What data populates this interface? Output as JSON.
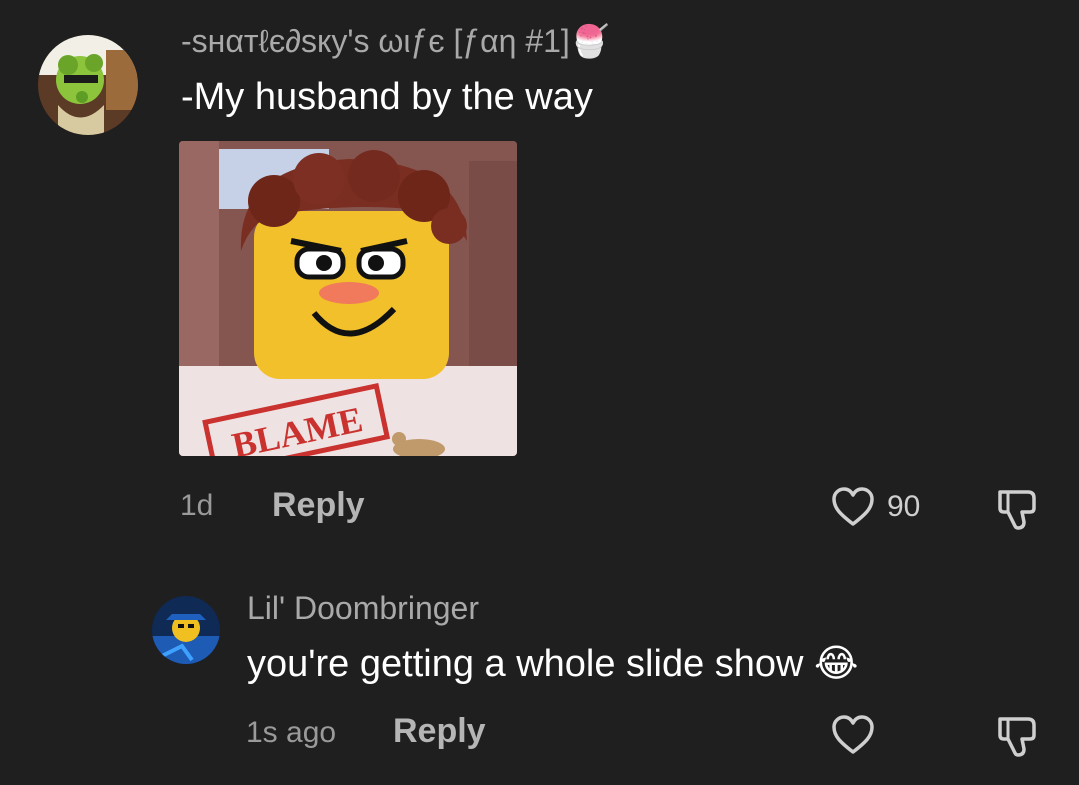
{
  "comments": [
    {
      "username": "-ѕнαтℓє∂ѕку's ωιƒє [ƒαη #1]",
      "username_emoji": "🍧",
      "text": "-My husband by the way",
      "attachment_caption": "BLAME",
      "time": "1d",
      "reply_label": "Reply",
      "like_count": "90",
      "avatar_icon": "green-character-avatar",
      "like_icon": "heart-outline-icon",
      "dislike_icon": "thumbs-down-outline-icon"
    },
    {
      "username": "Lil' Doombringer",
      "text": "you're getting a whole slide show",
      "text_emoji": "😂",
      "time": "1s ago",
      "reply_label": "Reply",
      "avatar_icon": "blue-character-avatar",
      "like_icon": "heart-outline-icon",
      "dislike_icon": "thumbs-down-outline-icon"
    }
  ],
  "colors": {
    "background": "#1f1f1f",
    "username": "#a9a9a9",
    "text": "#ffffff",
    "meta": "#9a9a9a"
  }
}
